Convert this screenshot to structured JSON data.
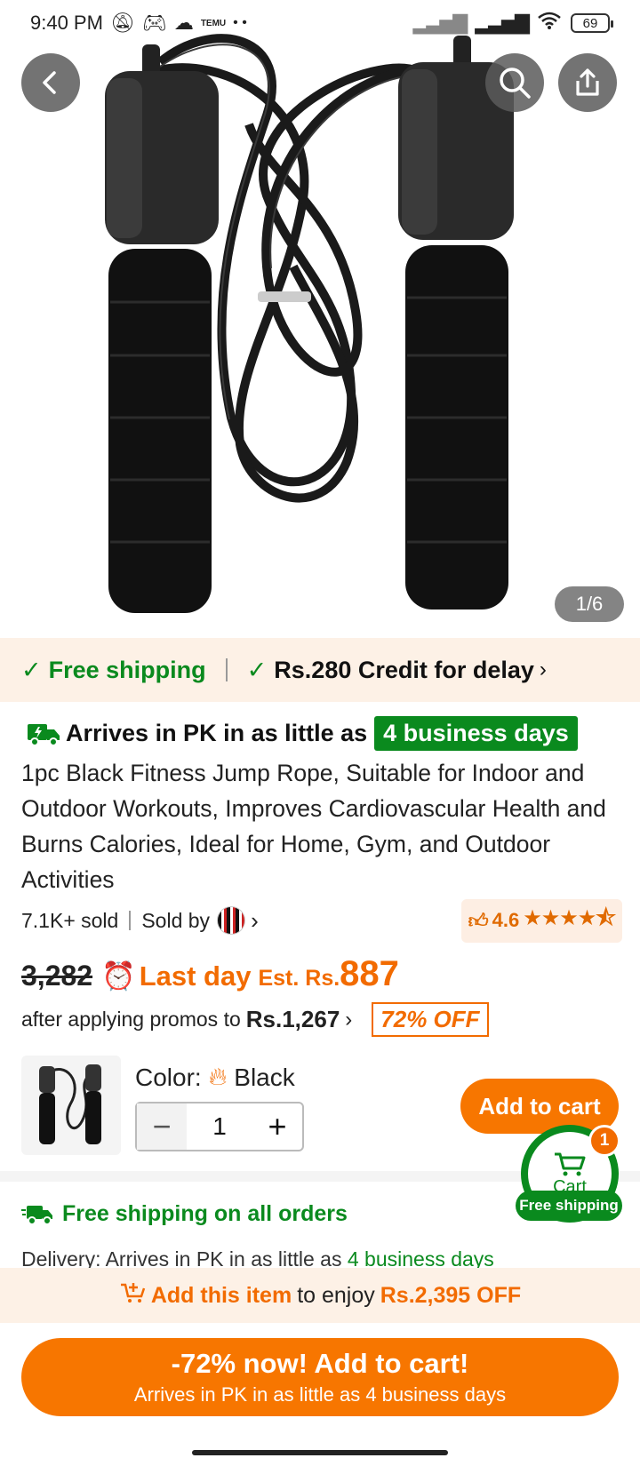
{
  "status_bar": {
    "time": "9:40 PM",
    "battery": "69",
    "dots": "• •",
    "app": "TEMU"
  },
  "hero": {
    "page_counter": "1/6"
  },
  "shipping_banner": {
    "free_shipping": "Free shipping",
    "credit": "Rs.280 Credit for delay"
  },
  "arrival": {
    "text": "Arrives in PK in as little as",
    "badge": "4 business days"
  },
  "product": {
    "title": "1pc Black Fitness Jump Rope, Suitable for Indoor and Outdoor Workouts, Improves Cardiovascular Health and Burns Calories, Ideal for Home, Gym, and Outdoor Activities",
    "sold": "7.1K+ sold",
    "sold_by": "Sold by",
    "rating": "4.6",
    "rating_value": 4.6
  },
  "price": {
    "old": "3,282",
    "last_day": "Last day",
    "est": "Est. Rs.",
    "value": "887",
    "promo_text": "after applying promos to",
    "promo_price": "Rs.1,267",
    "off": "72% OFF"
  },
  "variant": {
    "color_label": "Color:",
    "color_value": "Black",
    "qty": "1",
    "add_to_cart": "Add to cart"
  },
  "floating_cart": {
    "count": "1",
    "label": "Cart",
    "free": "Free shipping"
  },
  "free_all": "Free shipping on all orders",
  "delivery": {
    "label": "Delivery:",
    "text": "Arrives in PK in as little as",
    "days": "4 business days"
  },
  "promo_strip": {
    "a": "Add this item",
    "b": "to enjoy",
    "c": "Rs.2,395 OFF"
  },
  "cta": {
    "line1": "-72% now! Add to cart!",
    "line2": "Arrives in PK in as little as 4 business days"
  },
  "colors": {
    "brand_orange": "#f77600",
    "green": "#0a8a1e"
  }
}
